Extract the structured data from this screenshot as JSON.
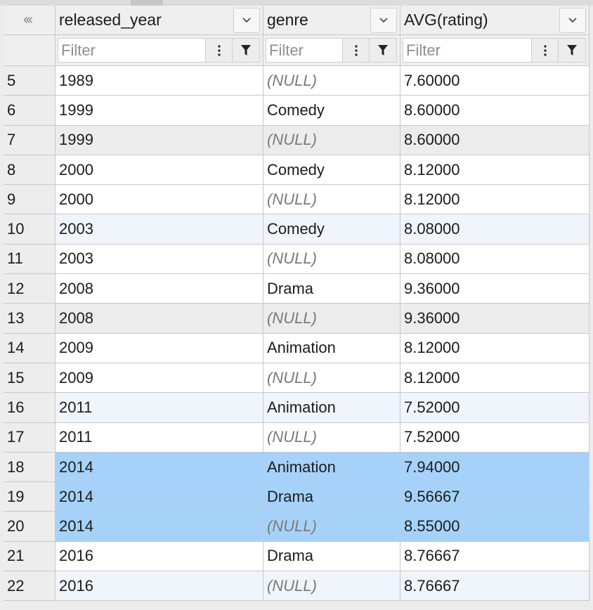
{
  "columns": {
    "corner_icon": "collapse-left-icon",
    "c1": {
      "name": "released_year"
    },
    "c2": {
      "name": "genre"
    },
    "c3": {
      "name": "AVG(rating)"
    }
  },
  "filters": {
    "placeholder": "Filter"
  },
  "null_text": "(NULL)",
  "colors": {
    "selection": "#a6d2f9"
  },
  "rows": [
    {
      "n": "5",
      "year": "1989",
      "genre": "(NULL)",
      "rating": "7.60000",
      "is_null": true,
      "style": "white"
    },
    {
      "n": "6",
      "year": "1999",
      "genre": "Comedy",
      "rating": "8.60000",
      "is_null": false,
      "style": "white"
    },
    {
      "n": "7",
      "year": "1999",
      "genre": "(NULL)",
      "rating": "8.60000",
      "is_null": true,
      "style": "grey"
    },
    {
      "n": "8",
      "year": "2000",
      "genre": "Comedy",
      "rating": "8.12000",
      "is_null": false,
      "style": "white"
    },
    {
      "n": "9",
      "year": "2000",
      "genre": "(NULL)",
      "rating": "8.12000",
      "is_null": true,
      "style": "white"
    },
    {
      "n": "10",
      "year": "2003",
      "genre": "Comedy",
      "rating": "8.08000",
      "is_null": false,
      "style": "tint"
    },
    {
      "n": "11",
      "year": "2003",
      "genre": "(NULL)",
      "rating": "8.08000",
      "is_null": true,
      "style": "white"
    },
    {
      "n": "12",
      "year": "2008",
      "genre": "Drama",
      "rating": "9.36000",
      "is_null": false,
      "style": "white"
    },
    {
      "n": "13",
      "year": "2008",
      "genre": "(NULL)",
      "rating": "9.36000",
      "is_null": true,
      "style": "grey"
    },
    {
      "n": "14",
      "year": "2009",
      "genre": "Animation",
      "rating": "8.12000",
      "is_null": false,
      "style": "white"
    },
    {
      "n": "15",
      "year": "2009",
      "genre": "(NULL)",
      "rating": "8.12000",
      "is_null": true,
      "style": "white"
    },
    {
      "n": "16",
      "year": "2011",
      "genre": "Animation",
      "rating": "7.52000",
      "is_null": false,
      "style": "tint"
    },
    {
      "n": "17",
      "year": "2011",
      "genre": "(NULL)",
      "rating": "7.52000",
      "is_null": true,
      "style": "white"
    },
    {
      "n": "18",
      "year": "2014",
      "genre": "Animation",
      "rating": "7.94000",
      "is_null": false,
      "style": "sel"
    },
    {
      "n": "19",
      "year": "2014",
      "genre": "Drama",
      "rating": "9.56667",
      "is_null": false,
      "style": "sel"
    },
    {
      "n": "20",
      "year": "2014",
      "genre": "(NULL)",
      "rating": "8.55000",
      "is_null": true,
      "style": "sel"
    },
    {
      "n": "21",
      "year": "2016",
      "genre": "Drama",
      "rating": "8.76667",
      "is_null": false,
      "style": "white"
    },
    {
      "n": "22",
      "year": "2016",
      "genre": "(NULL)",
      "rating": "8.76667",
      "is_null": true,
      "style": "tint"
    }
  ]
}
